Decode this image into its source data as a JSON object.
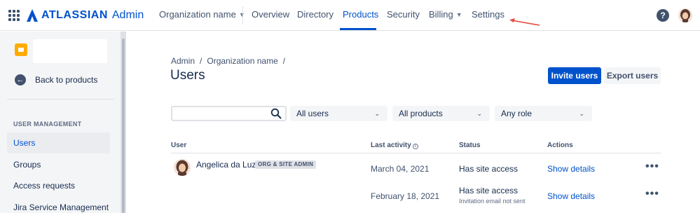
{
  "topnav": {
    "logo_text": "ATLASSIAN",
    "logo_product": "Admin",
    "org": "Organization name",
    "items": [
      "Overview",
      "Directory",
      "Products",
      "Security",
      "Billing",
      "Settings"
    ],
    "active": "Products",
    "colors": {
      "brand": "#0052CC",
      "annotation_arrow": "#E5493A"
    }
  },
  "sidebar": {
    "back_label": "Back to products",
    "section_label": "USER MANAGEMENT",
    "items": [
      "Users",
      "Groups",
      "Access requests",
      "Jira Service Management"
    ],
    "selected": "Users"
  },
  "main": {
    "breadcrumb": [
      "Admin",
      "Organization name"
    ],
    "title": "Users",
    "invite_button": "Invite users",
    "export_button": "Export users",
    "search": {
      "value": "",
      "placeholder": ""
    },
    "filters": [
      "All users",
      "All products",
      "Any role"
    ],
    "table": {
      "headers": [
        "User",
        "Last activity",
        "Status",
        "Actions"
      ],
      "rows": [
        {
          "name": "Angelica da Luz",
          "badge": "ORG & SITE ADMIN",
          "last_activity": "March 04, 2021",
          "status": "Has site access",
          "status_note": "",
          "action": "Show details"
        },
        {
          "name": "",
          "badge": "",
          "last_activity": "February 18, 2021",
          "status": "Has site access",
          "status_note": "Invitation email not sent",
          "action": "Show details"
        }
      ]
    }
  }
}
